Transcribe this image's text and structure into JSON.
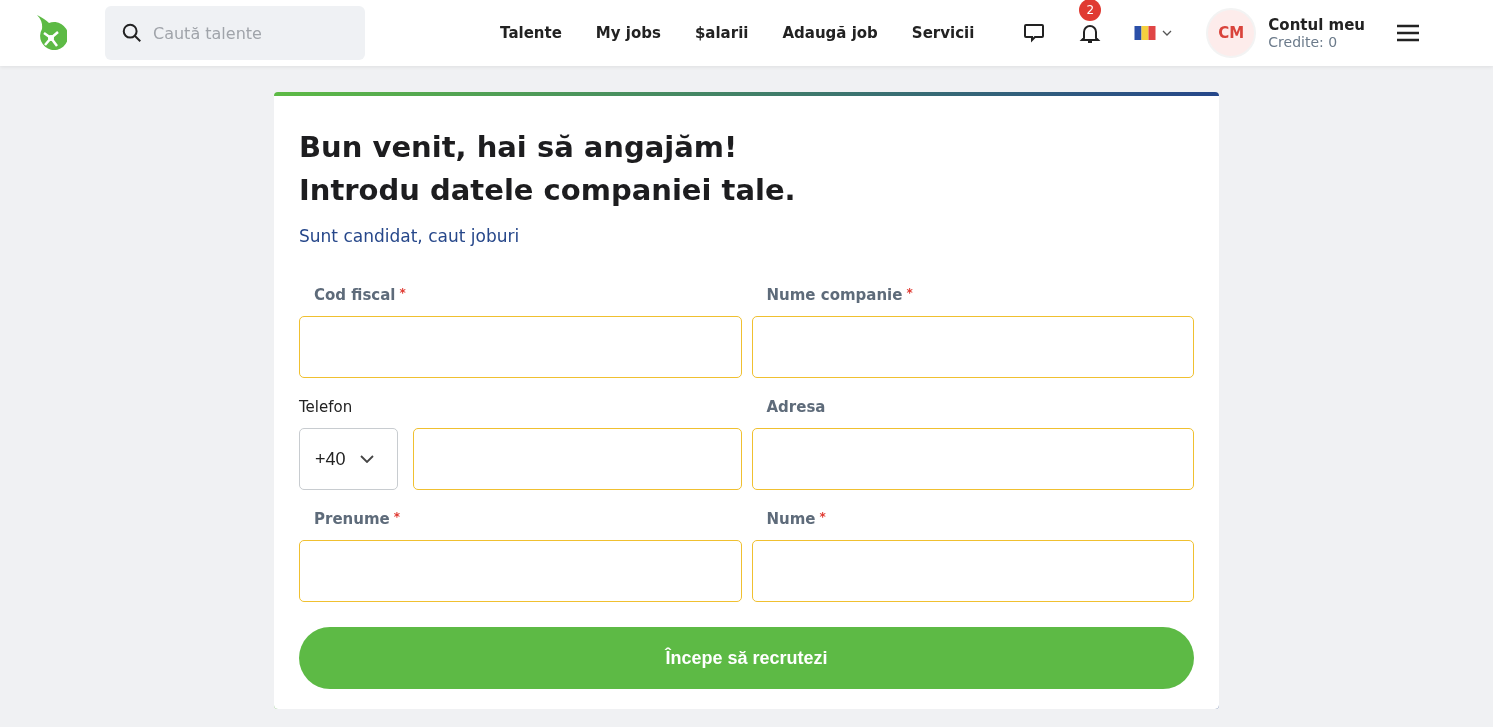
{
  "header": {
    "search": {
      "placeholder": "Caută talente"
    },
    "nav": [
      {
        "label": "Talente"
      },
      {
        "label": "My jobs"
      },
      {
        "label": "$alarii"
      },
      {
        "label": "Adaugă job"
      },
      {
        "label": "Servicii"
      }
    ],
    "notifications": {
      "badge": "2"
    },
    "account": {
      "initials": "CM",
      "title": "Contul meu",
      "credits": "Credite: 0"
    }
  },
  "form": {
    "title_lines": [
      "Bun venit, hai să angajăm!",
      "Introdu datele companiei tale."
    ],
    "candidate_link": "Sunt candidat, caut joburi",
    "fields": [
      {
        "kind": "text",
        "label": "Cod fiscal",
        "required_mark": "*"
      },
      {
        "kind": "text",
        "label": "Nume companie",
        "required_mark": "*"
      },
      {
        "kind": "phone",
        "label": "Telefon",
        "country_code": "+40"
      },
      {
        "kind": "text",
        "label": "Adresa"
      },
      {
        "kind": "text",
        "label": "Prenume",
        "required_mark": "*"
      },
      {
        "kind": "text",
        "label": "Nume",
        "required_mark": "*"
      }
    ],
    "submit": "Începe să recrutezi"
  }
}
